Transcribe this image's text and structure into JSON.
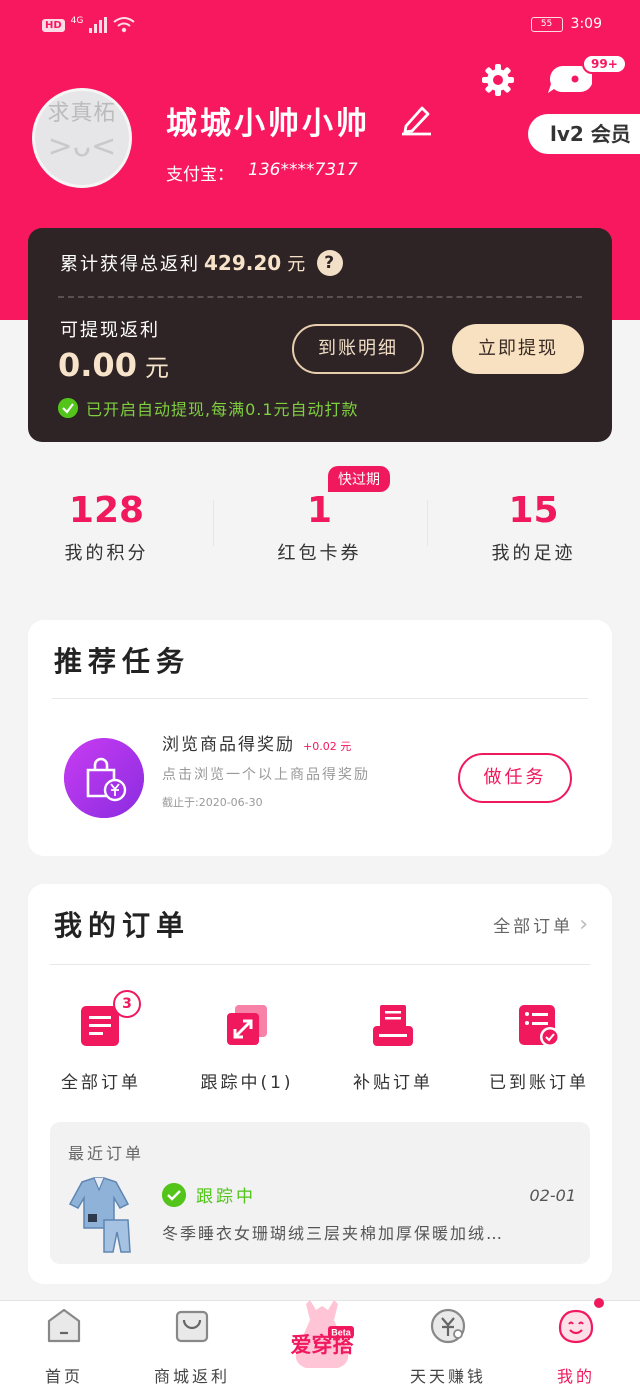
{
  "status_bar": {
    "hd": "HD",
    "network": "4G",
    "battery": "55",
    "time": "3:09"
  },
  "header": {
    "messages_badge": "99+",
    "level": "lv2 会员"
  },
  "profile": {
    "avatar_text": "求真柘",
    "avatar_face": ">ᴗ<",
    "username": "城城小帅小帅",
    "alipay_label": "支付宝：",
    "alipay_account": "136****7317"
  },
  "rebate": {
    "total_label": "累计获得总返利",
    "total_amount": "429.20",
    "total_unit": "元",
    "help": "?",
    "withdrawable_label": "可提现返利",
    "withdrawable_amount": "0.00",
    "withdrawable_unit": "元",
    "detail_button": "到账明细",
    "withdraw_button": "立即提现",
    "auto_notice": "已开启自动提现,每满0.1元自动打款"
  },
  "stats": {
    "points": {
      "value": "128",
      "label": "我的积分"
    },
    "coupons": {
      "value": "1",
      "label": "红包卡券",
      "tag": "快过期"
    },
    "footprints": {
      "value": "15",
      "label": "我的足迹"
    }
  },
  "tasks": {
    "title": "推荐任务",
    "item": {
      "name": "浏览商品得奖励",
      "reward": "+0.02 元",
      "desc": "点击浏览一个以上商品得奖励",
      "deadline": "截止于:2020-06-30",
      "button": "做任务"
    }
  },
  "orders": {
    "title": "我的订单",
    "all_link": "全部订单",
    "items": [
      {
        "label": "全部订单",
        "badge": "3"
      },
      {
        "label": "跟踪中(1)"
      },
      {
        "label": "补贴订单"
      },
      {
        "label": "已到账订单"
      }
    ],
    "recent": {
      "title": "最近订单",
      "status": "跟踪中",
      "date": "02-01",
      "product": "冬季睡衣女珊瑚绒三层夹棉加厚保暖加绒…"
    }
  },
  "nav": {
    "items": [
      {
        "label": "首页"
      },
      {
        "label": "商城返利"
      },
      {
        "label": "天天赚钱"
      },
      {
        "label": "我的"
      }
    ],
    "center_logo": "爱穿搭",
    "center_beta": "Beta"
  },
  "colors": {
    "brand": "#f8185f",
    "accent": "#f0195e",
    "card_dark": "#2e2426",
    "gold": "#f6e3c9",
    "success": "#52c41a"
  }
}
